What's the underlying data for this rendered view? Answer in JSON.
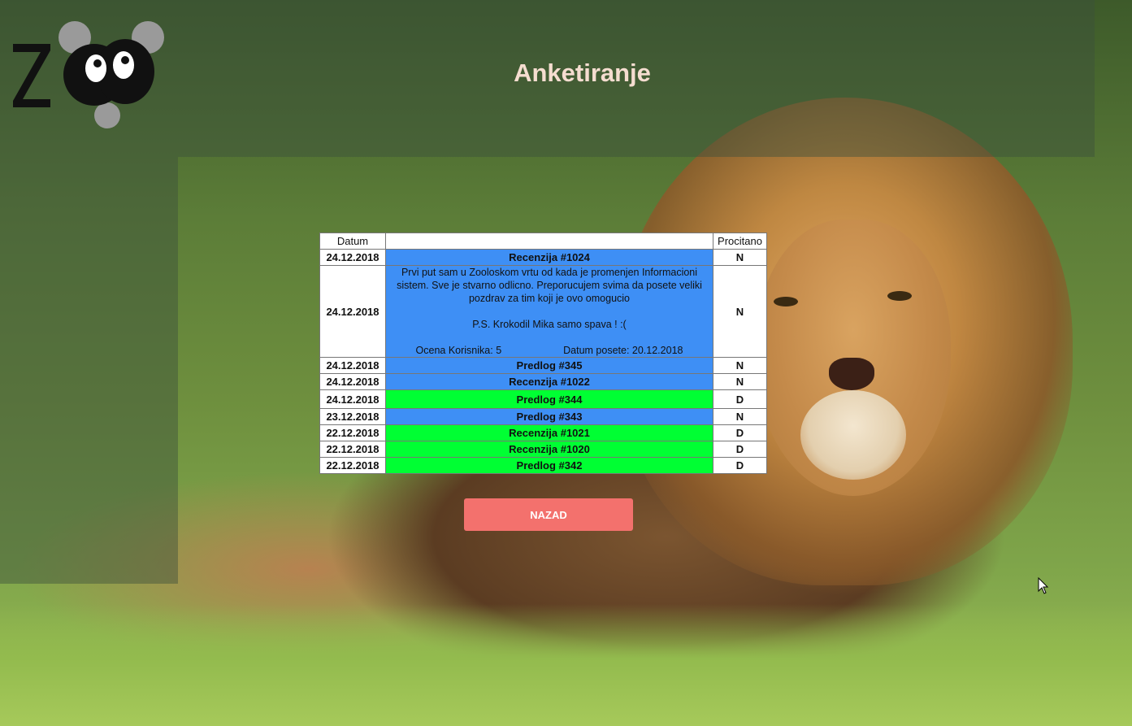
{
  "header": {
    "title": "Anketiranje",
    "logo_text": "ZOO"
  },
  "table": {
    "columns": [
      "Datum",
      "",
      "Procitano"
    ],
    "rows": [
      {
        "date": "24.12.2018",
        "title": "Recenzija #1024",
        "read": "N",
        "status": "unread"
      },
      {
        "date": "24.12.2018",
        "expanded": true,
        "status": "unread",
        "read": "N",
        "body_lines": [
          "Prvi put sam u Zooloskom vrtu od kada je promenjen Informacioni sistem. Sve je stvarno odlicno. Preporucujem svima da posete veliki pozdrav za tim koji je ovo omogucio",
          "P.S. Krokodil Mika samo spava ! :("
        ],
        "rating_label": "Ocena Korisnika: 5",
        "visit_label": "Datum posete: 20.12.2018"
      },
      {
        "date": "24.12.2018",
        "title": "Predlog #345",
        "read": "N",
        "status": "unread"
      },
      {
        "date": "24.12.2018",
        "title": "Recenzija #1022",
        "read": "N",
        "status": "unread"
      },
      {
        "date": "24.12.2018",
        "title": "Predlog #344",
        "read": "D",
        "status": "read"
      },
      {
        "date": "23.12.2018",
        "title": "Predlog #343",
        "read": "N",
        "status": "unread"
      },
      {
        "date": "22.12.2018",
        "title": "Recenzija #1021",
        "read": "D",
        "status": "read"
      },
      {
        "date": "22.12.2018",
        "title": "Recenzija #1020",
        "read": "D",
        "status": "read"
      },
      {
        "date": "22.12.2018",
        "title": "Predlog #342",
        "read": "D",
        "status": "read"
      }
    ]
  },
  "actions": {
    "back_label": "NAZAD"
  },
  "colors": {
    "unread": "#3e8ff5",
    "read": "#00ff33",
    "button": "#f3716d",
    "title": "#f5ddd0"
  }
}
